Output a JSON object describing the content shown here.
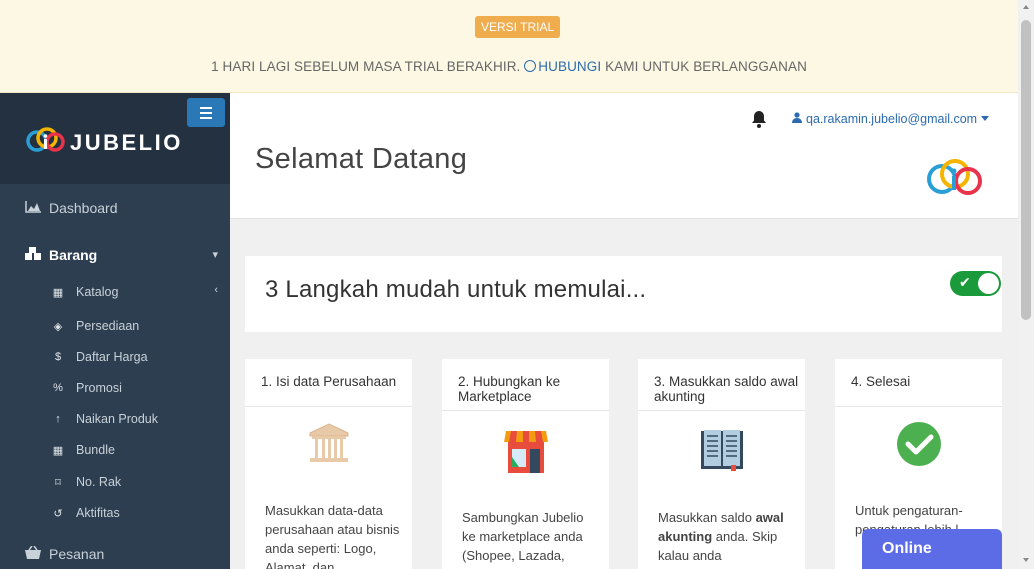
{
  "trial_banner": {
    "badge": "VERSI TRIAL",
    "message_before": "1 HARI LAGI SEBELUM MASA TRIAL BERAKHIR.",
    "link_text": "HUBUNGI",
    "message_after": "KAMI UNTUK BERLANGGANAN",
    "badge_color": "#f0ad4e",
    "background_color": "#fcf8e3"
  },
  "sidebar": {
    "brand": "JUBELIO",
    "menu_toggle_icon": "bars-icon",
    "items": [
      {
        "label": "Dashboard",
        "icon": "area-chart-icon"
      },
      {
        "label": "Barang",
        "icon": "cubes-icon",
        "active": true
      },
      {
        "label": "Pesanan",
        "icon": "basket-icon"
      }
    ],
    "sub_items": [
      {
        "label": "Katalog",
        "icon": "grid-icon"
      },
      {
        "label": "Persediaan",
        "icon": "cubes-icon"
      },
      {
        "label": "Daftar Harga",
        "icon": "dollar-icon"
      },
      {
        "label": "Promosi",
        "icon": "percent-icon"
      },
      {
        "label": "Naikan Produk",
        "icon": "arrow-up-icon"
      },
      {
        "label": "Bundle",
        "icon": "grid-icon"
      },
      {
        "label": "No. Rak",
        "icon": "bookmark-icon"
      },
      {
        "label": "Aktifitas",
        "icon": "history-icon"
      }
    ],
    "background_color": "#2c3e50"
  },
  "header": {
    "title": "Selamat Datang",
    "user_email": "qa.rakamin.jubelio@gmail.com"
  },
  "steps_panel": {
    "title": "3 Langkah mudah untuk memulai...",
    "toggle_on": true
  },
  "cards": [
    {
      "title": "1. Isi data Perusahaan",
      "icon": "bank-icon",
      "body": "Masukkan data-data perusahaan atau bisnis anda seperti: Logo, Alamat, dan"
    },
    {
      "title": "2. Hubungkan ke Marketplace",
      "icon": "store-icon",
      "body": "Sambungkan Jubelio ke marketplace anda (Shopee, Lazada,"
    },
    {
      "title": "3. Masukkan saldo awal akunting",
      "icon": "ledger-book-icon",
      "body_before": "Masukkan saldo",
      "body_bold": "awal akunting",
      "body_after": "anda. Skip kalau anda"
    },
    {
      "title": "4. Selesai",
      "icon": "check-circle-icon",
      "body": "Untuk pengaturan-pengaturan lebih l..."
    }
  ],
  "chat_widget": {
    "label": "Online",
    "color": "#5b6ce6"
  }
}
